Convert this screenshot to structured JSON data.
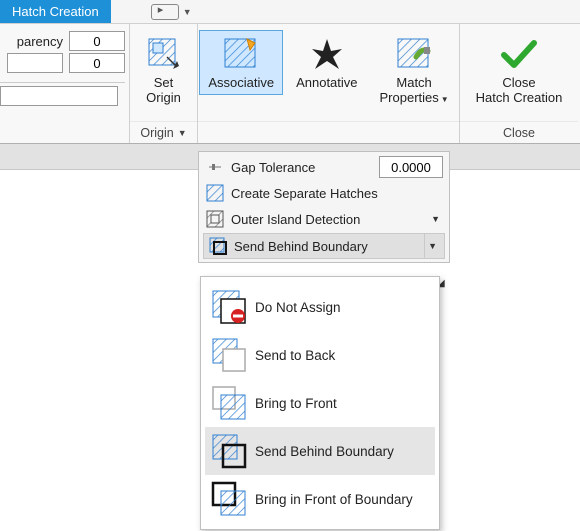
{
  "colors": {
    "accent": "#1e90d8",
    "hatch": "#2f7fd1",
    "ok": "#2fa82f"
  },
  "tab": {
    "label": "Hatch Creation"
  },
  "left_frag": {
    "transparency_label": "parency",
    "transparency_value": "0",
    "second_value": "0"
  },
  "origin_panel": {
    "btn_label_line1": "Set",
    "btn_label_line2": "Origin",
    "title": "Origin"
  },
  "options_panel": {
    "associative": "Associative",
    "annotative": "Annotative",
    "match_line1": "Match",
    "match_line2": "Properties"
  },
  "close_panel": {
    "line1": "Close",
    "line2": "Hatch Creation",
    "title": "Close"
  },
  "drop": {
    "gap_label": "Gap Tolerance",
    "gap_value": "0.0000",
    "sep_hatches": "Create Separate Hatches",
    "island": "Outer Island Detection",
    "draw_order": "Send Behind Boundary"
  },
  "flyout": {
    "items": [
      {
        "label": "Do Not Assign"
      },
      {
        "label": "Send to Back"
      },
      {
        "label": "Bring to Front"
      },
      {
        "label": "Send Behind Boundary"
      },
      {
        "label": "Bring in Front of Boundary"
      }
    ],
    "selected_index": 3
  }
}
